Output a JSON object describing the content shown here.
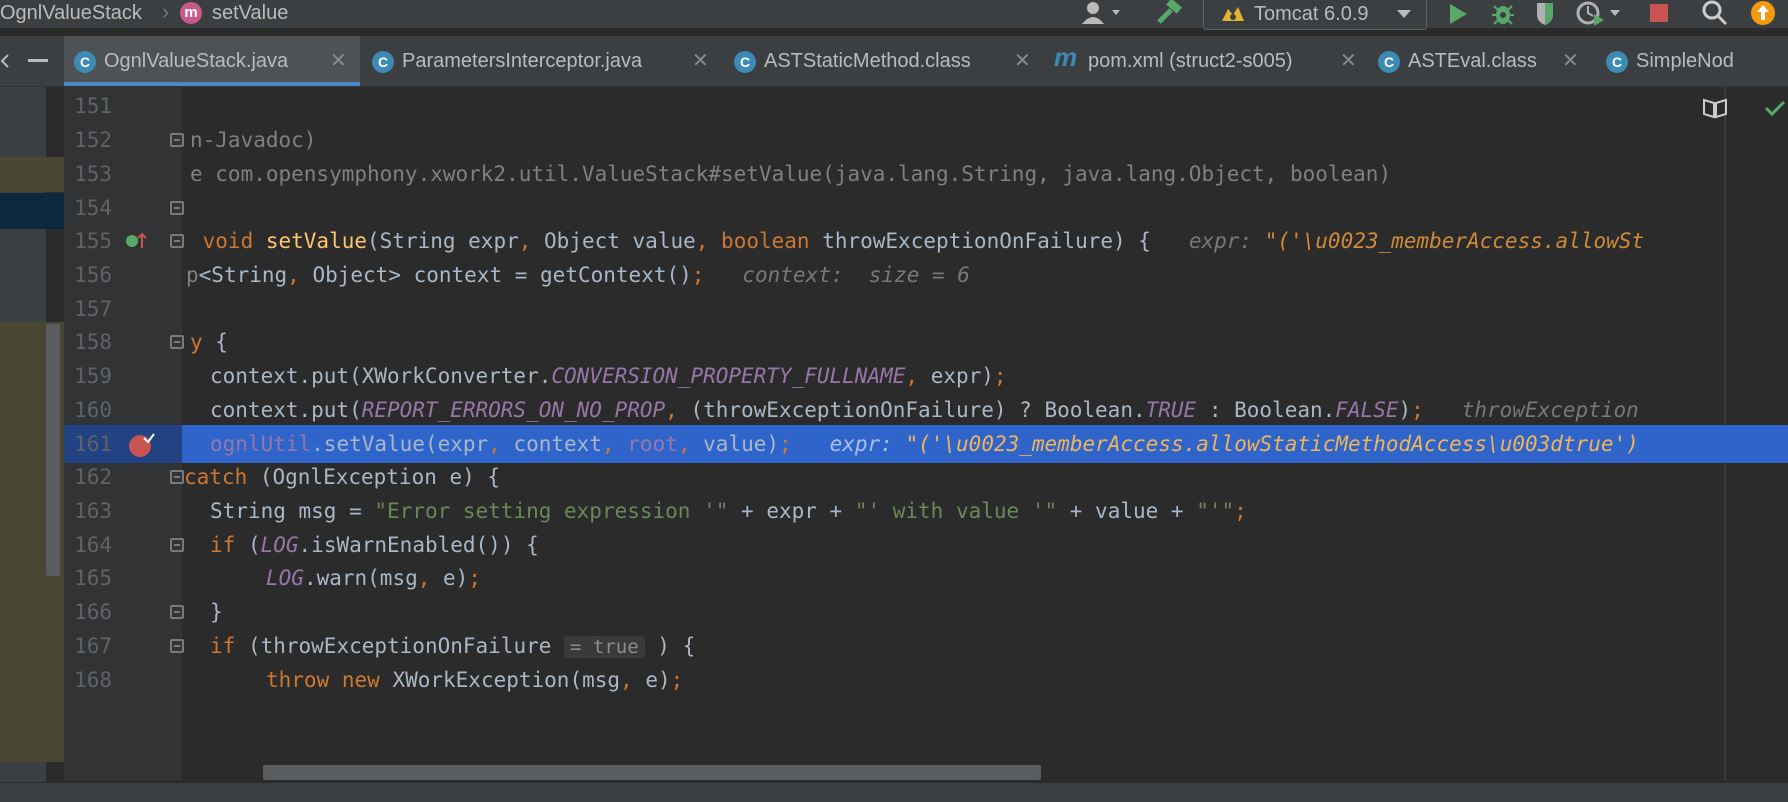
{
  "navbar": {
    "breadcrumb_class": "OgnlValueStack",
    "breadcrumb_method": "setValue",
    "method_badge": "m",
    "run_config": "Tomcat 6.0.9"
  },
  "tabs": [
    {
      "label": "OgnlValueStack.java",
      "icon": "C",
      "active": true
    },
    {
      "label": "ParametersInterceptor.java",
      "icon": "C",
      "active": false
    },
    {
      "label": "ASTStaticMethod.class",
      "icon": "C",
      "active": false
    },
    {
      "label": "pom.xml (struct2-s005)",
      "icon": "m",
      "active": false
    },
    {
      "label": "ASTEval.class",
      "icon": "C",
      "active": false
    },
    {
      "label": "SimpleNod",
      "icon": "C",
      "active": false
    }
  ],
  "editor": {
    "lines": [
      {
        "num": "151",
        "text": ""
      },
      {
        "num": "152",
        "text": "n-Javadoc)"
      },
      {
        "num": "153",
        "text": "e com.opensymphony.xwork2.util.ValueStack#setValue(java.lang.String, java.lang.Object, boolean)"
      },
      {
        "num": "154",
        "text": ""
      },
      {
        "num": "155",
        "text": " void setValue(String expr, Object value, boolean throwExceptionOnFailure) {"
      },
      {
        "num": "156",
        "text": "p<String, Object> context = getContext();"
      },
      {
        "num": "157",
        "text": ""
      },
      {
        "num": "158",
        "text": "y {"
      },
      {
        "num": "159",
        "text": "  context.put(XWorkConverter.CONVERSION_PROPERTY_FULLNAME, expr);"
      },
      {
        "num": "160",
        "text": "  context.put(REPORT_ERRORS_ON_NO_PROP, (throwExceptionOnFailure) ? Boolean.TRUE : Boolean.FALSE);"
      },
      {
        "num": "161",
        "text": "  ognlUtil.setValue(expr, context, root, value);"
      },
      {
        "num": "162",
        "text": "catch (OgnlException e) {"
      },
      {
        "num": "163",
        "text": "  String msg = \"Error setting expression '\" + expr + \"' with value '\" + value + \"'\";"
      },
      {
        "num": "164",
        "text": "  if (LOG.isWarnEnabled()) {"
      },
      {
        "num": "165",
        "text": "      LOG.warn(msg, e);"
      },
      {
        "num": "166",
        "text": "  }"
      },
      {
        "num": "167",
        "text": "  if (throwExceptionOnFailure"
      },
      {
        "num": "168",
        "text": "      throw new XWorkException(msg, e);"
      }
    ],
    "hints": {
      "h155_label": "expr: ",
      "h155_value": "\"('\\u0023_memberAccess.allowSt",
      "h156": "context:  size = 6",
      "h160": "throwException",
      "h161_label": "expr: ",
      "h161_value": "\"('\\u0023_memberAccess.allowStaticMethodAccess\\u003dtrue')",
      "h167_chip": "= true",
      "h167_rest": " ) {"
    }
  },
  "colors": {
    "background": "#2b2b2b",
    "keyword": "#cc7832",
    "function": "#ffc66d",
    "string": "#6a8759",
    "field": "#9876aa",
    "selection": "#2f65ca",
    "breakpoint": "#c75450"
  },
  "icons": [
    "user-icon",
    "build-hammer-icon",
    "tomcat-icon",
    "run-icon",
    "debug-icon",
    "coverage-icon",
    "profile-icon",
    "stop-icon",
    "search-icon",
    "update-icon",
    "reader-mode-icon",
    "inspection-ok-icon",
    "breakpoint-icon",
    "override-icon"
  ]
}
